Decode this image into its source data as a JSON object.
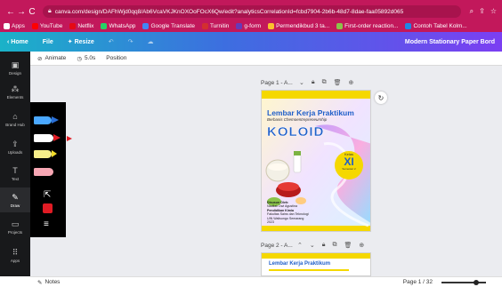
{
  "browser": {
    "url": "canva.com/design/DAFhWjd0qq8/Ab6VcaVKJKnOXOoFOcX6Qw/edit?analyticsCorrelationId=fcbd7904-2b6b-48d7-8dae-faa05892d065",
    "bookmarks": [
      {
        "label": "Apps",
        "color": "#ffffff"
      },
      {
        "label": "YouTube",
        "color": "#ff0000"
      },
      {
        "label": "Netflix",
        "color": "#e50914"
      },
      {
        "label": "WhatsApp",
        "color": "#25d366"
      },
      {
        "label": "Google Translate",
        "color": "#4285f4"
      },
      {
        "label": "Turnitin",
        "color": "#d32f2f"
      },
      {
        "label": "g-form",
        "color": "#673ab7"
      },
      {
        "label": "Permendikbud 3 ta...",
        "color": "#fbc02d"
      },
      {
        "label": "First-order reaction...",
        "color": "#8bc34a"
      },
      {
        "label": "Contoh Tabel Kolm...",
        "color": "#1e88e5"
      }
    ]
  },
  "topbar": {
    "home": "Home",
    "file": "File",
    "resize": "Resize",
    "document_title": "Modern Stationary Paper Bord"
  },
  "sidebar": {
    "items": [
      {
        "label": "Design",
        "icon": "layout-icon"
      },
      {
        "label": "Elements",
        "icon": "shapes-icon"
      },
      {
        "label": "Brand Hub",
        "icon": "brand-icon"
      },
      {
        "label": "Uploads",
        "icon": "upload-icon"
      },
      {
        "label": "Text",
        "icon": "text-icon"
      },
      {
        "label": "Draw",
        "icon": "draw-icon"
      },
      {
        "label": "Projects",
        "icon": "folder-icon"
      },
      {
        "label": "Apps",
        "icon": "apps-icon"
      }
    ]
  },
  "toolbar": {
    "animate": "Animate",
    "duration": "5.0s",
    "position": "Position"
  },
  "pages": {
    "page1_label": "Page 1 - A...",
    "page2_label": "Page 2 - A...",
    "cover": {
      "title": "Lembar Kerja Praktikum",
      "subtitle": "Berbasis Chemoentrepreneurship",
      "topic": "KOLOID",
      "class_label": "Kelas",
      "class_value": "XI",
      "class_sub": "Semester 2",
      "author_label": "Disusun Oleh:",
      "author_name": "Nadilah Dwi Agustina",
      "dept": "Pendidikan Kimia",
      "faculty": "Fakultas Sains dan Teknologi",
      "university": "UIN Walisongo Semarang",
      "year": "2023"
    },
    "page2_title": "Lembar Kerja Praktikum"
  },
  "bottom": {
    "notes": "Notes",
    "page_indicator": "Page 1 / 32"
  },
  "colors": {
    "accent": "#7b3ff2",
    "browser": "#c2185b",
    "cover_yellow": "#f5d800",
    "cover_blue": "#1f5fc9"
  }
}
